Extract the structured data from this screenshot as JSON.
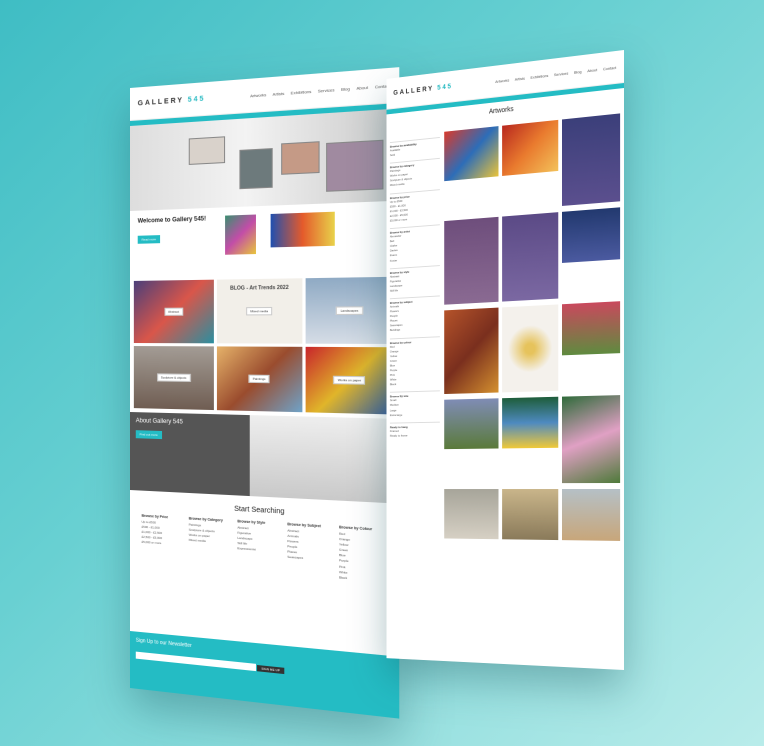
{
  "brand": {
    "name": "GALLERY",
    "number": "545"
  },
  "left": {
    "nav": [
      "Artworks",
      "Artists",
      "Exhibitions",
      "Services",
      "Blog",
      "About",
      "Contact"
    ],
    "welcome": {
      "title": "Welcome to Gallery 545!",
      "button": "Read more"
    },
    "tiles": [
      "Abstract",
      "Mixed media",
      "Landscapes",
      "Sculpture & objects",
      "Paintings",
      "Works on paper"
    ],
    "blog_title": "BLOG - Art Trends 2022",
    "about": {
      "title": "About Gallery 545",
      "button": "Find out more"
    },
    "search": {
      "title": "Start Searching",
      "columns": [
        {
          "head": "Browse by Price",
          "items": [
            "Up to £500",
            "£500 - £1,000",
            "£1,000 - £2,500",
            "£2,500 - £5,000",
            "£5,000 or more"
          ]
        },
        {
          "head": "Browse by Category",
          "items": [
            "Paintings",
            "Sculpture & objects",
            "Works on paper",
            "Mixed media"
          ]
        },
        {
          "head": "Browse by Style",
          "items": [
            "Abstract",
            "Figurative",
            "Landscape",
            "Still life",
            "Expressionist"
          ]
        },
        {
          "head": "Browse by Subject",
          "items": [
            "Abstract",
            "Animals",
            "Flowers",
            "People",
            "Places",
            "Seascapes"
          ]
        },
        {
          "head": "Browse by Colour",
          "items": [
            "Red",
            "Orange",
            "Yellow",
            "Green",
            "Blue",
            "Purple",
            "Pink",
            "White",
            "Black"
          ]
        }
      ]
    },
    "newsletter": {
      "title": "Sign Up to our Newsletter",
      "button": "SIGN ME UP"
    }
  },
  "right": {
    "nav": [
      "Artworks",
      "Artists",
      "Exhibitions",
      "Services",
      "Blog",
      "About",
      "Contact"
    ],
    "title": "Artworks",
    "filters": [
      {
        "head": "Browse by availability",
        "items": [
          "Available",
          "Sold"
        ]
      },
      {
        "head": "Browse by category",
        "items": [
          "Paintings",
          "Works on paper",
          "Sculpture & objects",
          "Mixed media"
        ]
      },
      {
        "head": "Browse by price",
        "items": [
          "Up to £500",
          "£500 - £1,000",
          "£1,000 - £2,500",
          "£2,500 - £5,000",
          "£5,000 or more"
        ]
      },
      {
        "head": "Browse by artist",
        "items": [
          "Alexander",
          "Bell",
          "Clarke",
          "Davies",
          "Evans",
          "Foster"
        ]
      },
      {
        "head": "Browse by style",
        "items": [
          "Abstract",
          "Figurative",
          "Landscape",
          "Still life"
        ]
      },
      {
        "head": "Browse by subject",
        "items": [
          "Animals",
          "Flowers",
          "People",
          "Places",
          "Seascapes",
          "Buildings"
        ]
      },
      {
        "head": "Browse by colour",
        "items": [
          "Red",
          "Orange",
          "Yellow",
          "Green",
          "Blue",
          "Purple",
          "Pink",
          "White",
          "Black"
        ]
      },
      {
        "head": "Browse by size",
        "items": [
          "Small",
          "Medium",
          "Large",
          "Extra large"
        ]
      },
      {
        "head": "Ready to hang",
        "items": [
          "Framed",
          "Ready to frame"
        ]
      }
    ]
  },
  "colors": {
    "teal": "#24bcc4",
    "grey": "#555555"
  }
}
